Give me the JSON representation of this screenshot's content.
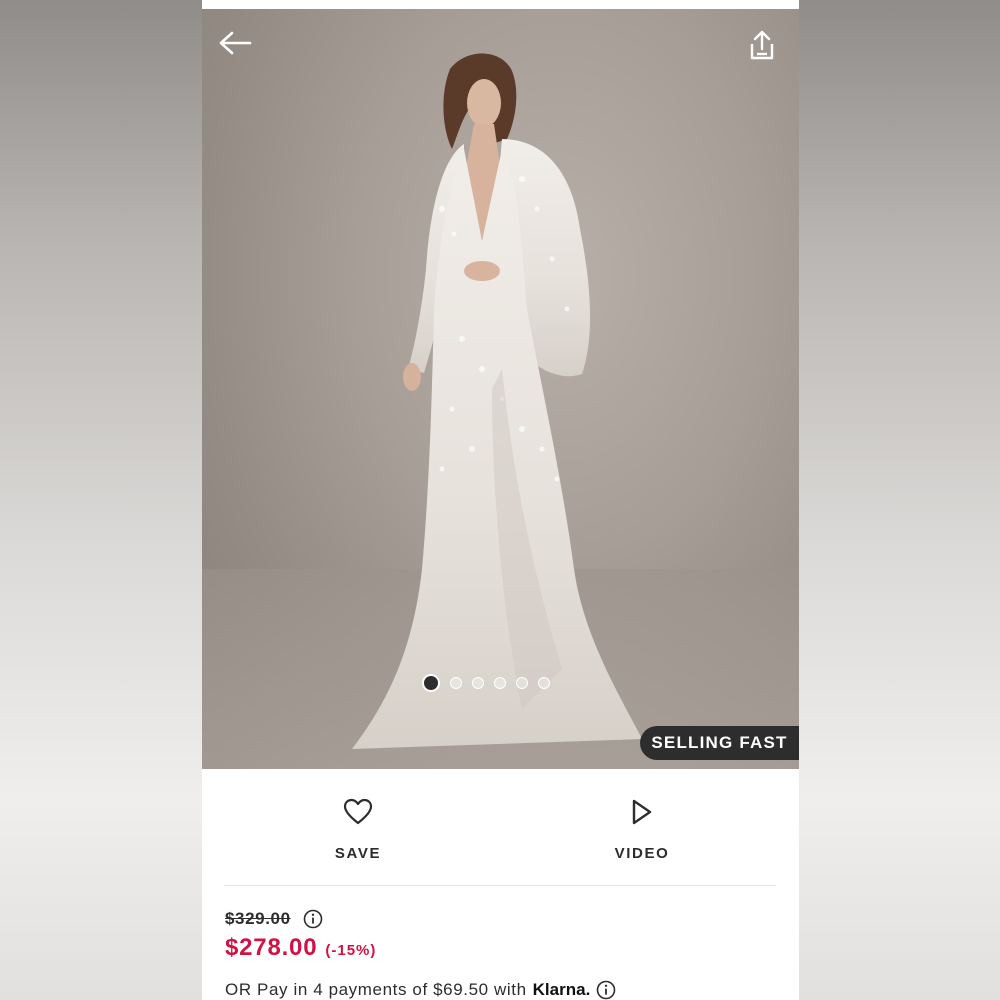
{
  "colors": {
    "accent_sale": "#d01345",
    "ink": "#2d2d2d",
    "badge_bg": "#2d2d2d",
    "badge_text": "#ffffff"
  },
  "header": {
    "back_icon": "arrow-left-icon",
    "share_icon": "share-icon"
  },
  "gallery": {
    "image_count": 6,
    "active_index": 0,
    "badge": "SELLING FAST"
  },
  "actions": {
    "save_label": "SAVE",
    "save_icon": "heart-outline-icon",
    "video_label": "VIDEO",
    "video_icon": "play-outline-icon"
  },
  "pricing": {
    "was_price": "$329.00",
    "now_price": "$278.00",
    "discount": "(-15%)",
    "info_icon": "info-circle-icon"
  },
  "klarna": {
    "text": "OR Pay in 4 payments of $69.50 with",
    "brand": "Klarna.",
    "info_icon": "info-circle-icon"
  }
}
